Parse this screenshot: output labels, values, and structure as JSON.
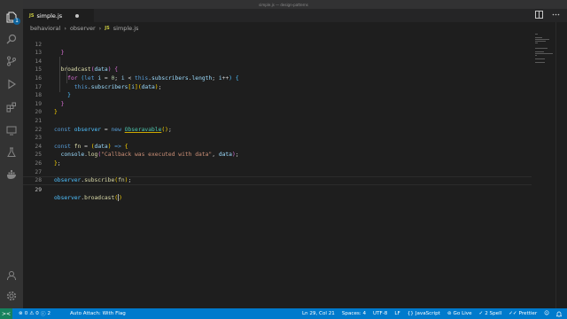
{
  "window": {
    "title": "simple.js — design-patterns"
  },
  "activity_bar": {
    "explorer_badge": "1",
    "icons": [
      "files-icon",
      "search-icon",
      "source-control-icon",
      "run-debug-icon",
      "extensions-icon",
      "remote-explorer-icon",
      "testing-icon",
      "docker-icon"
    ],
    "bottom_icons": [
      "account-icon",
      "gear-icon"
    ]
  },
  "tabs": [
    {
      "icon": "JS",
      "label": "simple.js",
      "dirty": true
    }
  ],
  "breadcrumb": {
    "folder": "behavioral",
    "subfolder": "observer",
    "file_icon": "JS",
    "file": "simple.js"
  },
  "editor": {
    "line_numbers": [
      "12",
      "13",
      "14",
      "15",
      "16",
      "17",
      "18",
      "19",
      "20",
      "21",
      "22",
      "23",
      "24",
      "25",
      "26",
      "27",
      "28",
      "29"
    ],
    "current_line": "29"
  },
  "status_bar": {
    "remote_icon": "><",
    "errors": "0",
    "warnings": "0",
    "info": "2",
    "auto_attach": "Auto Attach: With Flag",
    "position": "Ln 29, Col 21",
    "spaces": "Spaces: 4",
    "encoding": "UTF-8",
    "eol": "LF",
    "language": "JavaScript",
    "go_live": "Go Live",
    "spell": "2 Spell",
    "prettier": "Prettier"
  },
  "colors": {
    "statusbar": "#007acc",
    "editor_bg": "#1e1e1e",
    "activitybar": "#333333"
  }
}
